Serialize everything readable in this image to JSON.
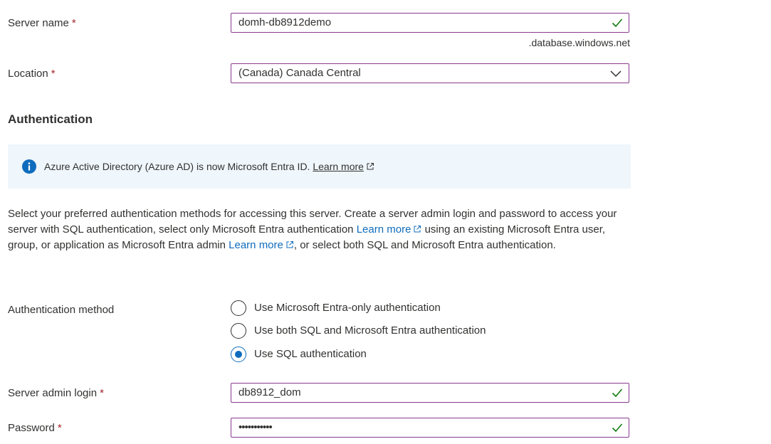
{
  "server_name": {
    "label": "Server name",
    "required_mark": "*",
    "value": "domh-db8912demo",
    "suffix": ".database.windows.net"
  },
  "location": {
    "label": "Location",
    "required_mark": "*",
    "value": "(Canada) Canada Central"
  },
  "authentication": {
    "title": "Authentication",
    "info_text": "Azure Active Directory (Azure AD) is now Microsoft Entra ID.",
    "info_link": "Learn more",
    "desc_part1": "Select your preferred authentication methods for accessing this server. Create a server admin login and password to access your server with SQL authentication, select only Microsoft Entra authentication",
    "desc_link1": "Learn more",
    "desc_part2": "using an existing Microsoft Entra user, group, or application as Microsoft Entra admin",
    "desc_link2": "Learn more",
    "desc_part3": ", or select both SQL and Microsoft Entra authentication."
  },
  "auth_method": {
    "label": "Authentication method",
    "options": [
      {
        "label": "Use Microsoft Entra-only authentication",
        "selected": false
      },
      {
        "label": "Use both SQL and Microsoft Entra authentication",
        "selected": false
      },
      {
        "label": "Use SQL authentication",
        "selected": true
      }
    ]
  },
  "admin_login": {
    "label": "Server admin login",
    "required_mark": "*",
    "value": "db8912_dom"
  },
  "password": {
    "label": "Password",
    "required_mark": "*",
    "value": "•••••••••••"
  },
  "colors": {
    "field_border": "#8a3a8f",
    "valid_check": "#107c10",
    "link": "#0f6cbd",
    "info_bg": "#eff6fc",
    "required": "#a4262c"
  }
}
